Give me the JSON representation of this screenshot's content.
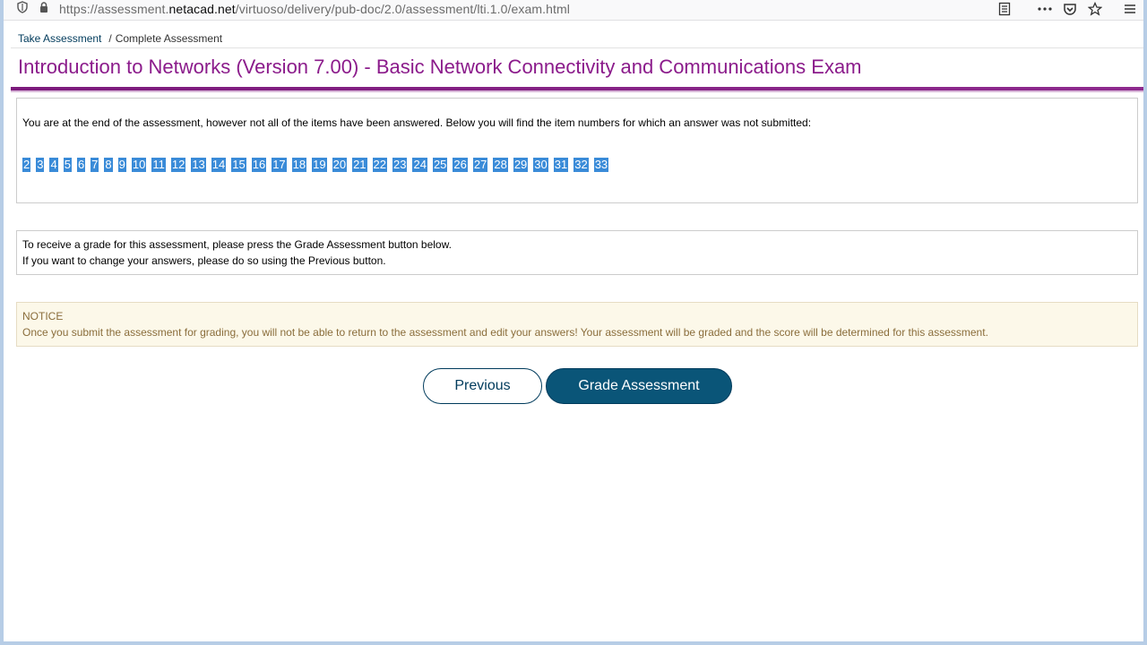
{
  "browser": {
    "url_prefix": "https://assessment.",
    "url_domain": "netacad.net",
    "url_path": "/virtuoso/delivery/pub-doc/2.0/assessment/lti.1.0/exam.html",
    "icons": [
      "shield-icon",
      "lock-icon",
      "reader-view-icon",
      "more-icon",
      "pocket-icon",
      "star-icon",
      "menu-icon"
    ]
  },
  "breadcrumb": {
    "link": "Take Assessment",
    "separator": "/",
    "current": "Complete Assessment"
  },
  "page_title": "Introduction to Networks (Version 7.00) - Basic Network Connectivity and Communications Exam",
  "unanswered": {
    "message": "You are at the end of the assessment, however not all of the items have been answered. Below you will find the item numbers for which an answer was not submitted:",
    "items": [
      "2",
      "3",
      "4",
      "5",
      "6",
      "7",
      "8",
      "9",
      "10",
      "11",
      "12",
      "13",
      "14",
      "15",
      "16",
      "17",
      "18",
      "19",
      "20",
      "21",
      "22",
      "23",
      "24",
      "25",
      "26",
      "27",
      "28",
      "29",
      "30",
      "31",
      "32",
      "33"
    ]
  },
  "grade_info": {
    "line1": "To receive a grade for this assessment, please press the Grade Assessment button below.",
    "line2": "If you want to change your answers, please do so using the Previous button."
  },
  "notice": {
    "heading": "NOTICE",
    "text": "Once you submit the assessment for grading, you will not be able to return to the assessment and edit your answers! Your assessment will be graded and the score will be determined for this assessment."
  },
  "buttons": {
    "previous": "Previous",
    "grade": "Grade Assessment"
  },
  "colors": {
    "title": "#8b1b8b",
    "item_badge": "#3a8bd8",
    "primary_button": "#0a5578",
    "notice_bg": "#fcf8e9",
    "notice_text": "#8a6d3b"
  }
}
